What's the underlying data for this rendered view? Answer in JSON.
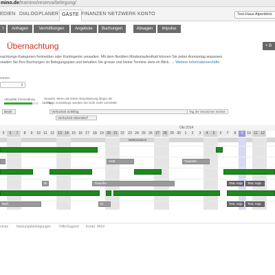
{
  "browser": {
    "url_host": "mino.de",
    "url_path": "/tramino/reserva/belegung/"
  },
  "topnav": {
    "items": [
      {
        "label": "EDIEN",
        "active": false
      },
      {
        "label": "DIALOG",
        "active": false
      },
      {
        "label": "PLANER",
        "active": false
      },
      {
        "label": "GÄSTE",
        "active": true
      },
      {
        "label": "FINANZEN",
        "active": false
      },
      {
        "label": "NETZWERK",
        "active": false
      },
      {
        "label": "KONTO",
        "active": false
      }
    ],
    "test_button": "Test-Haus Alpenblick"
  },
  "subnav": {
    "tabs": [
      "t",
      "Anfragen",
      "Vermittlungen",
      "Angebote",
      "Buchungen",
      "Absagen",
      "Impulse"
    ]
  },
  "page": {
    "title": "Übernachtung",
    "plus_button": "+ B",
    "description_line1": "nachtungs-Kategorien freimelden oder Kontingente verwalten. Mit dem flexiblen Mindestaufenthalt können Sie jeden Anreisetag anpassen",
    "description_line2": "rwalten Sie Ihre Buchungen im Belegungsplan und behalten Sie grosse und kleine Termine stets im Blick.",
    "description_link": "→ Weitere Informationen/Hilfe",
    "zone_label": "zonen:",
    "zone_select_value": ""
  },
  "status": {
    "label": "Aktualität Freimeldung",
    "progress_fraction": 0.82,
    "progress_value": "24 Tag",
    "hint_line1": "Hinweis: Wenn die letzte Aktualisierung länger als",
    "hint_line2": "14 Tage zurückliegt, werden Sie nicht mehr vermittelt."
  },
  "holidays": [
    {
      "label": "Beoth"
    },
    {
      "label": "Verhacheit Schilfing"
    },
    {
      "label": "Verhacheit Oberstdorf"
    },
    {
      "label": "Tag der Deutschen Einheit"
    }
  ],
  "calendar": {
    "month_label": "Okt 2014",
    "days_sep": [
      "5",
      "6",
      "7",
      "8",
      "9",
      "10",
      "11",
      "12",
      "13",
      "14",
      "15",
      "16",
      "17",
      "18",
      "19",
      "20",
      "21",
      "22",
      "23",
      "24",
      "25",
      "26",
      "27",
      "28",
      "29",
      "30"
    ],
    "days_oct": [
      "1",
      "2",
      "3",
      "4",
      "5",
      "6",
      "7",
      "8",
      "9",
      "10",
      "11",
      "12"
    ],
    "banner": "Nebensaison",
    "booking_labels": {
      "acb": "ACB",
      "traum": "Traumfer",
      "traum2": "Traumfer",
      "w": "W",
      "west": "Waif",
      "m": "M",
      "test1": "Test. Anja",
      "test2": "Test. Anja",
      "test3": "Test. Anja",
      "test4": "Test. Anja"
    }
  },
  "footer": {
    "items": [
      "chutz",
      "Nutzungsbedingungen",
      "Hilfe/Support",
      "Konto: 9410"
    ]
  },
  "colors": {
    "accent": "#cc2e1f",
    "booked": "#1e8a1e",
    "today": "#9b9bd8"
  }
}
